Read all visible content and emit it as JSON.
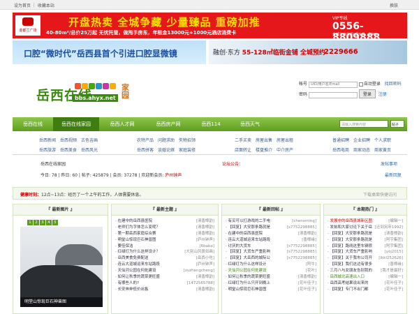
{
  "topbar": {
    "home": "设为首页",
    "fav": "收藏本站",
    "skin": "换肤"
  },
  "ad1": {
    "logo_text": "金都兰广场",
    "headline": "开盘热卖  全城争藏  少量臻品  重磅加推",
    "sub": "40-80m²/总价25万起   无忧托管，做甩手房东，年租金13000元+1000元酒店消费卡",
    "hotline_label": "VIP专线",
    "hotline": "0556-8809888",
    "address": "金都兰商业街(现天骨、醉吧)"
  },
  "ad2": {
    "left": "口腔“微时代”岳西县首个引进口腔显微镜",
    "right_pre": "融创·东方",
    "right_mid": "55-128㎡临街金铺  全城预约",
    "right_phone": "2229666"
  },
  "logo": {
    "cn": "岳西在线",
    "url": "bbs.ahyx.net",
    "jiayuan": "家园"
  },
  "login": {
    "account_label": "帐号",
    "account_placeholder": "UID/用户名/Email",
    "remember": "自动登录",
    "forgot": "找回密码",
    "password_label": "密码",
    "login_btn": "登录",
    "register": "注册"
  },
  "nav": {
    "items": [
      "岳西在线",
      "岳西在线家园",
      "岳西人才网",
      "岳西房产网",
      "岳西114",
      "岳西天气"
    ],
    "search_placeholder": "请输入搜索内容",
    "search_type": "帖子"
  },
  "subnav": {
    "group1": [
      [
        "岳西新闻",
        "岳西视频",
        "古色吉画"
      ],
      [
        "岳西旅游",
        "岳西美食",
        "岳西风光"
      ]
    ],
    "group2": [
      [
        "农特产品",
        "问题求助",
        "失物招领"
      ],
      [
        "岳西拼客",
        "谈婚论嫁",
        "家庭装修"
      ]
    ],
    "group3": [
      [
        "二手买卖",
        "房屋出售",
        "房屋出租"
      ],
      [
        "店面转让",
        "楼盘推介",
        "中介房产"
      ]
    ],
    "group4": [
      [
        "普通招聘",
        "企业招聘",
        "个人求职"
      ],
      [
        "岳西电商",
        "商家动态",
        "商家黄页"
      ]
    ]
  },
  "strip": {
    "crumb": "岳西在线家园",
    "announce": "论坛公告：",
    "help": "发帖事项"
  },
  "stats": {
    "text": "今日: 78 | 昨日: 60 | 帖子: 425879 | 会员: 37278 | 欢迎新会员:",
    "newmember": "庐州钟声",
    "latest": "最新回复"
  },
  "notice": {
    "label": "健康时刻：",
    "text": "12点~13点：经历了一个上午的工作，人体需要休息。",
    "right": "下载桌面快捷访问"
  },
  "panels": {
    "pic_title": "最新图片",
    "pic_caption": "明堂山惊现巨石神兽图",
    "pic_pages": [
      "1",
      "2",
      "3",
      "4",
      "5"
    ],
    "topics_title": "最新主题",
    "topics": [
      {
        "t": "在建中的岳西县医院",
        "a": "[清香樟韵]"
      },
      {
        "t": "老师们为字体怎么变呢？",
        "a": "[清香樟韵]"
      },
      {
        "t": "第一期岳西家庭综合赛",
        "a": "[清香樟韵]"
      },
      {
        "t": "明堂山惊现巨石神兽图",
        "a": "[庐州钟声]"
      },
      {
        "t": "要佳保洁",
        "a": "[6baba]"
      },
      {
        "t": "红绿灯为什么这样设计？",
        "a": "[大别山风景如画]"
      },
      {
        "t": "岳西美食免费配送",
        "a": "[岳西小吃]"
      },
      {
        "t": "连云大道城运来车站路段",
        "a": "[庐州钟声]"
      },
      {
        "t": "天仙河公园在何处建设",
        "a": "[zuzhengcheng]"
      },
      {
        "t": "如何让秋季的蔬菜更旺盛",
        "a": "[清香樟韵]"
      },
      {
        "t": "有哪些人的?",
        "a": "[1472565788]"
      },
      {
        "t": "长安奔奔低价出售",
        "a": "[清香樟韵]"
      }
    ],
    "replies_title": "最新回帖",
    "replies": [
      {
        "t": "有买可以打游戏的二手电",
        "a": "[chenxming]",
        "c": ""
      },
      {
        "t": "【回复】大安那条路就是",
        "a": "[s7752298885]",
        "c": ""
      },
      {
        "t": "在建中的岳西县医院",
        "a": "[清香樟韵]",
        "c": ""
      },
      {
        "t": "连云大道城运来车站路段",
        "a": "[香樟缘]",
        "c": ""
      },
      {
        "t": "讨厌的大货车",
        "a": "[s7752298885]",
        "c": ""
      },
      {
        "t": "【回复】大货车严重影响",
        "a": "[s7752298885]",
        "c": ""
      },
      {
        "t": "【回复】大岳西的城际公",
        "a": "[s7752298885]",
        "c": ""
      },
      {
        "t": "红绿灯为什么这样设计",
        "a": "[阿牛]",
        "c": ""
      },
      {
        "t": "天仙河公园在何处建设",
        "a": "[花叶]",
        "c": "grn"
      },
      {
        "t": "如何让秋季的蔬菜更旺盛",
        "a": "[清香樟韵]",
        "c": ""
      },
      {
        "t": "红绿灯为什么只开到晚上",
        "a": "[花叶佳子]",
        "c": ""
      },
      {
        "t": "明堂山惊现巨石神兽图",
        "a": "[花叶佳子]",
        "c": ""
      }
    ],
    "hot_title": "本期热门",
    "hot": [
      {
        "t": "发展中的岳西县城新区图",
        "a": "[编辑一]",
        "c": "red"
      },
      {
        "t": "发帖和大家讨论下关于岳",
        "a": "[迁到另年1992]",
        "c": ""
      },
      {
        "t": "【回复】大安那条路就是",
        "a": "[清香樟韵]",
        "c": ""
      },
      {
        "t": "【回复】大安那条路就是",
        "a": "[阿宇集团]",
        "c": ""
      },
      {
        "t": "【回复】路线这里车辆很",
        "a": "[阿宇集团]",
        "c": ""
      },
      {
        "t": "【回复】大货车严重影响",
        "a": "[yoj2015]",
        "c": ""
      },
      {
        "t": "【回复】关于我市公司开",
        "a": "[lkkl252626]",
        "c": ""
      },
      {
        "t": "【回复】我们这边有很多",
        "a": "[香樟缘]",
        "c": ""
      },
      {
        "t": "三月八与女朋友告别我的",
        "a": "[我才是最好]",
        "c": ""
      },
      {
        "t": "岳西城北高速出入口",
        "a": "[编辑一]",
        "c": "grn"
      },
      {
        "t": "岳西高考结果说出来的",
        "a": "[花叶佳子]",
        "c": ""
      },
      {
        "t": "【回复】专门不出门都",
        "a": "[花叶佳子]",
        "c": ""
      }
    ]
  },
  "colors": {
    "nav_green": "#5d9e1f",
    "banner_red": "#e5171a",
    "logo_green": "#3b8a10",
    "alert_red": "#cc0000"
  }
}
